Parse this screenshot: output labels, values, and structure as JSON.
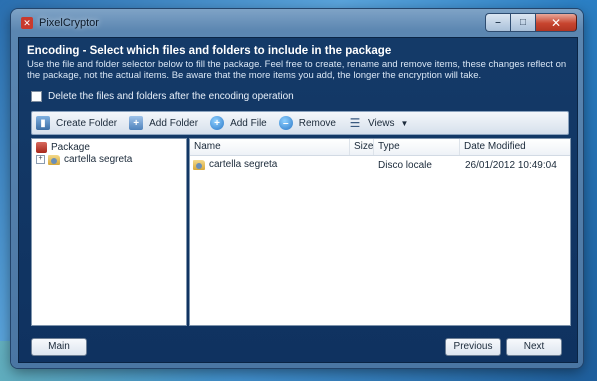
{
  "window": {
    "title": "PixelCryptor"
  },
  "header": {
    "heading": "Encoding - Select which files and folders to include in the package",
    "description": "Use the file and folder selector below to fill the package. Feel free to create, rename and remove items, these changes reflect on the package, not the actual items. Be aware that the more items you add, the longer the encryption will take."
  },
  "options": {
    "delete_after_label": "Delete the files and folders after the encoding operation",
    "delete_after_checked": false
  },
  "toolbar": {
    "create_folder": "Create Folder",
    "add_folder": "Add Folder",
    "add_file": "Add File",
    "remove": "Remove",
    "views": "Views"
  },
  "tree": {
    "root": "Package",
    "children": [
      "cartella segreta"
    ]
  },
  "list": {
    "columns": [
      "Name",
      "Size",
      "Type",
      "Date Modified"
    ],
    "rows": [
      {
        "name": "cartella segreta",
        "size": "",
        "type": "Disco locale",
        "date_modified": "26/01/2012 10:49:04"
      }
    ]
  },
  "footer": {
    "main": "Main",
    "previous": "Previous",
    "next": "Next"
  }
}
